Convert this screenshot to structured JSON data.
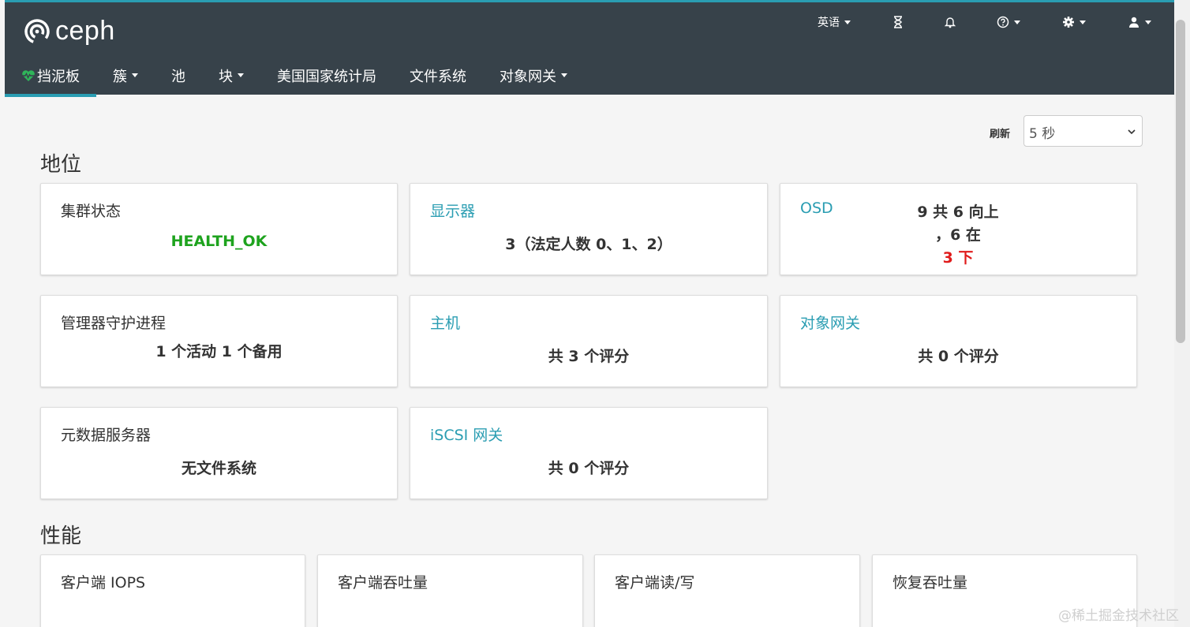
{
  "app": {
    "logo_text": "ceph"
  },
  "topbar": {
    "language_label": "英语",
    "icons": [
      "hourglass-icon",
      "bell-icon",
      "help-icon",
      "gear-icon",
      "user-icon"
    ]
  },
  "nav": {
    "items": [
      {
        "label": "挡泥板",
        "active": true,
        "dropdown": false
      },
      {
        "label": "簇",
        "dropdown": true
      },
      {
        "label": "池",
        "dropdown": false
      },
      {
        "label": "块",
        "dropdown": true
      },
      {
        "label": "美国国家统计局",
        "dropdown": false
      },
      {
        "label": "文件系统",
        "dropdown": false
      },
      {
        "label": "对象网关",
        "dropdown": true
      }
    ]
  },
  "refresh": {
    "label": "刷新",
    "value": "5 秒"
  },
  "status": {
    "title": "地位",
    "cluster_status": {
      "title": "集群状态",
      "value": "HEALTH_OK"
    },
    "monitors": {
      "title": "显示器",
      "value": "3（法定人数 0、1、2）"
    },
    "osd": {
      "title": "OSD",
      "line1": "9 共 6 向上",
      "line2": "，6 在",
      "line3": "3 下"
    },
    "manager": {
      "title": "管理器守护进程",
      "value": "1 个活动 1 个备用"
    },
    "hosts": {
      "title": "主机",
      "value": "共 3 个评分"
    },
    "object_gateway": {
      "title": "对象网关",
      "value": "共 0 个评分"
    },
    "metadata_servers": {
      "title": "元数据服务器",
      "value": "无文件系统"
    },
    "iscsi_gateway": {
      "title": "iSCSI 网关",
      "value": "共 0 个评分"
    }
  },
  "performance": {
    "title": "性能",
    "cards": [
      "客户端 IOPS",
      "客户端吞吐量",
      "客户端读/写",
      "恢复吞吐量"
    ]
  },
  "watermark": "@稀土掘金技术社区",
  "colors": {
    "accent": "#2a9db2",
    "topbar": "#37424a",
    "ok": "#1ea31e",
    "down": "#e01b1b"
  }
}
